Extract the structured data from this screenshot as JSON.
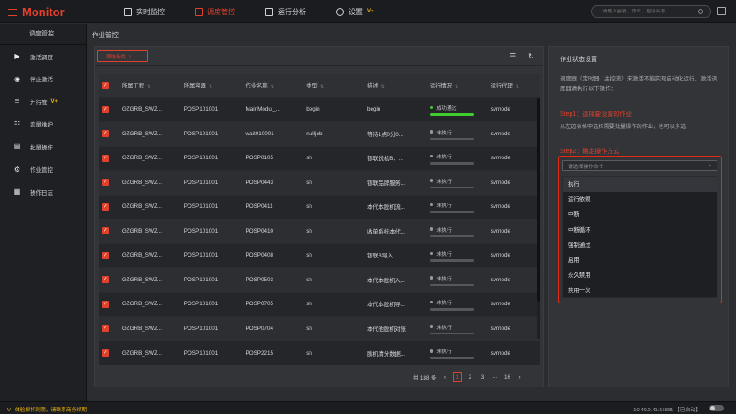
{
  "app": {
    "title": "Monitor"
  },
  "topnav": [
    {
      "label": "实时监控",
      "icon": "monitor-icon",
      "active": false
    },
    {
      "label": "调度管控",
      "icon": "schedule-icon",
      "active": true
    },
    {
      "label": "运行分析",
      "icon": "analysis-icon",
      "active": false
    },
    {
      "label": "设置",
      "icon": "gear-icon",
      "active": false,
      "badge": "V+"
    }
  ],
  "search": {
    "placeholder": "请输入容器、作业、程序名称"
  },
  "sidebar": {
    "title": "调度管控",
    "items": [
      {
        "label": "激活调度",
        "icon": "play-icon"
      },
      {
        "label": "停止激活",
        "icon": "stop-icon"
      },
      {
        "label": "并行度",
        "icon": "parallel-icon",
        "badge": "V+"
      },
      {
        "label": "变量维护",
        "icon": "variable-icon"
      },
      {
        "label": "批量操作",
        "icon": "batch-icon"
      },
      {
        "label": "作业管控",
        "icon": "job-icon"
      },
      {
        "label": "操作日志",
        "icon": "log-icon"
      }
    ]
  },
  "breadcrumb": "作业管控",
  "toolbar": {
    "filter_label": "筛选条件"
  },
  "table": {
    "columns": [
      "所属工程",
      "所属容器",
      "作业名称",
      "类型",
      "描述",
      "运行情况",
      "运行代理"
    ],
    "rows": [
      [
        "GZGRB_SWZ...",
        "POSP101001",
        "MainModul_...",
        "begin",
        "begin",
        "成功通过",
        "svrnode"
      ],
      [
        "GZGRB_SWZ...",
        "POSP101001",
        "wait010001",
        "nulljob",
        "等待1点0分0...",
        "未执行",
        "svrnode"
      ],
      [
        "GZGRB_SWZ...",
        "POSP101001",
        "POSP0105",
        "sh",
        "银联脱机B、...",
        "未执行",
        "svrnode"
      ],
      [
        "GZGRB_SWZ...",
        "POSP101001",
        "POSP0443",
        "sh",
        "银联品牌服务...",
        "未执行",
        "svrnode"
      ],
      [
        "GZGRB_SWZ...",
        "POSP101001",
        "POSP0411",
        "sh",
        "本代本脱机流...",
        "未执行",
        "svrnode"
      ],
      [
        "GZGRB_SWZ...",
        "POSP101001",
        "POSP0410",
        "sh",
        "收单系统本代...",
        "未执行",
        "svrnode"
      ],
      [
        "GZGRB_SWZ...",
        "POSP101001",
        "POSP0408",
        "sh",
        "银联B导入",
        "未执行",
        "svrnode"
      ],
      [
        "GZGRB_SWZ...",
        "POSP101001",
        "POSP0503",
        "sh",
        "本代本脱机入...",
        "未执行",
        "svrnode"
      ],
      [
        "GZGRB_SWZ...",
        "POSP101001",
        "POSP0705",
        "sh",
        "本代本脱机导...",
        "未执行",
        "svrnode"
      ],
      [
        "GZGRB_SWZ...",
        "POSP101001",
        "POSP0704",
        "sh",
        "本代他脱机对账",
        "未执行",
        "svrnode"
      ],
      [
        "GZGRB_SWZ...",
        "POSP101001",
        "POSP2215",
        "sh",
        "脱机清分数据...",
        "未执行",
        "svrnode"
      ]
    ],
    "status_progress": [
      1,
      0,
      0,
      0,
      0,
      0,
      0,
      0,
      0,
      0,
      0
    ]
  },
  "pager": {
    "total": "共 188 条",
    "prev": "‹",
    "pages": [
      "1",
      "2",
      "3",
      "···",
      "16"
    ],
    "next": "›",
    "active_page": "1"
  },
  "right": {
    "title": "作业状态设置",
    "desc": "调度器（定时器 / 主控流）未激活不能实现自动化运行，激活调度器请执行以下操作：",
    "step1": "Step1：选择要设置的作业",
    "step1_desc": "从左边表格中选择需要批量操作的作业，也可以多选",
    "step2": "Step2：确定操作方式",
    "select_placeholder": "请选择操作命令",
    "options": [
      "执行",
      "运行依赖",
      "中断",
      "中断循环",
      "强制通过",
      "启用",
      "永久禁用",
      "禁用一次"
    ]
  },
  "statusbar": {
    "notice": "V+ 体验即将到期，请联系商务续期",
    "ip": "10.40.0.41:16881 【已启动】"
  },
  "colors": {
    "accent": "#e0402c",
    "success": "#3fce2e",
    "vip": "#f0b90b",
    "bg": "#2b2d31"
  }
}
